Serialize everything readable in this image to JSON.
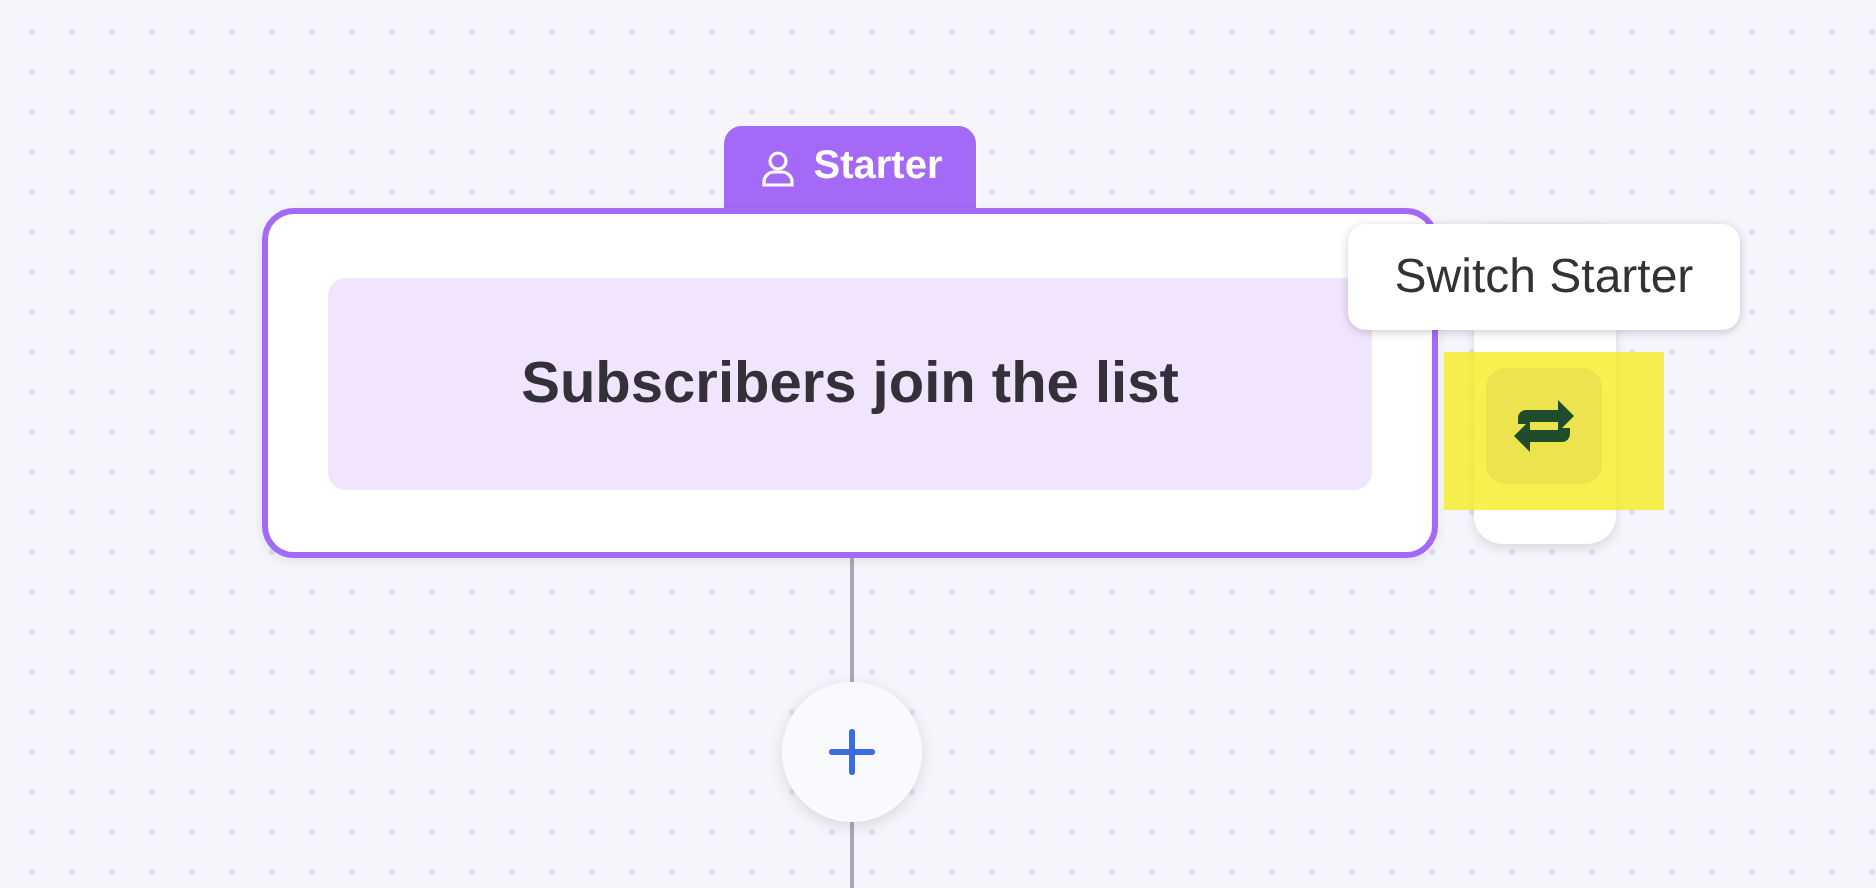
{
  "node": {
    "badge": "Starter",
    "title": "Subscribers join the list"
  },
  "switch_button": {
    "tooltip": "Switch Starter",
    "highlighted": true
  }
}
